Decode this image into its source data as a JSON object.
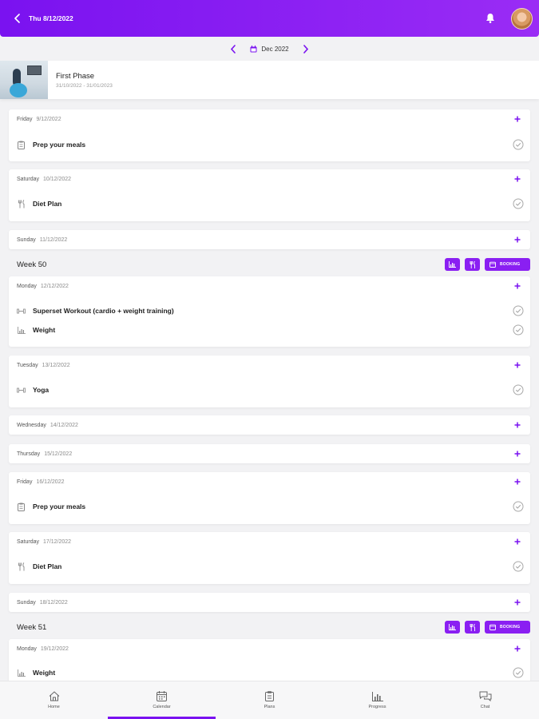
{
  "header": {
    "title": "Thu 8/12/2022",
    "back_icon": "chevron-left-icon",
    "bell_icon": "bell-icon"
  },
  "month_bar": {
    "label": "Dec 2022",
    "icon": "calendar-icon"
  },
  "phase": {
    "title": "First Phase",
    "dates": "31/10/2022 - 31/01/2023"
  },
  "colors": {
    "accent": "#7a12f0",
    "button": "#8a1ff2"
  },
  "days": [
    {
      "day": "Friday",
      "date": "9/12/2022",
      "tasks": [
        {
          "label": "Prep your meals",
          "icon": "clipboard-icon"
        }
      ]
    },
    {
      "day": "Saturday",
      "date": "10/12/2022",
      "tasks": [
        {
          "label": "Diet Plan",
          "icon": "cutlery-icon"
        }
      ]
    },
    {
      "day": "Sunday",
      "date": "11/12/2022",
      "tasks": []
    },
    {
      "day": "Monday",
      "date": "12/12/2022",
      "tasks": [
        {
          "label": "Superset Workout (cardio + weight training)",
          "icon": "dumbbell-icon"
        },
        {
          "label": "Weight",
          "icon": "bar-chart-icon"
        }
      ]
    },
    {
      "day": "Tuesday",
      "date": "13/12/2022",
      "tasks": [
        {
          "label": "Yoga",
          "icon": "dumbbell-icon"
        }
      ]
    },
    {
      "day": "Wednesday",
      "date": "14/12/2022",
      "tasks": []
    },
    {
      "day": "Thursday",
      "date": "15/12/2022",
      "tasks": []
    },
    {
      "day": "Friday",
      "date": "16/12/2022",
      "tasks": [
        {
          "label": "Prep your meals",
          "icon": "clipboard-icon"
        }
      ]
    },
    {
      "day": "Saturday",
      "date": "17/12/2022",
      "tasks": [
        {
          "label": "Diet Plan",
          "icon": "cutlery-icon"
        }
      ]
    },
    {
      "day": "Sunday",
      "date": "18/12/2022",
      "tasks": []
    },
    {
      "day": "Monday",
      "date": "19/12/2022",
      "tasks": [
        {
          "label": "Weight",
          "icon": "bar-chart-icon"
        }
      ]
    }
  ],
  "weeks": [
    {
      "label": "Week 50",
      "booking": "BOOKING"
    },
    {
      "label": "Week 51",
      "booking": "BOOKING"
    }
  ],
  "tabs": [
    {
      "label": "Home",
      "icon": "home-icon"
    },
    {
      "label": "Calendar",
      "icon": "calendar-icon",
      "active": true
    },
    {
      "label": "Plans",
      "icon": "clipboard-icon"
    },
    {
      "label": "Progress",
      "icon": "bar-chart-icon"
    },
    {
      "label": "Chat",
      "icon": "chat-icon"
    }
  ]
}
